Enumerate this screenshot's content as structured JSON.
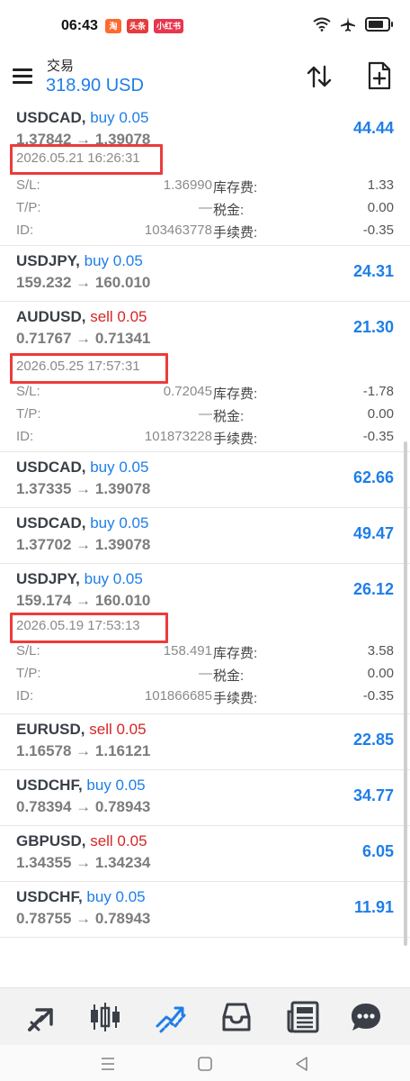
{
  "status": {
    "time": "06:43",
    "badge1": "淘",
    "badge2": "头条",
    "badge3": "小红书"
  },
  "header": {
    "title": "交易",
    "balance": "318.90 USD"
  },
  "labels": {
    "sl": "S/L:",
    "tp": "T/P:",
    "id": "ID:",
    "swap": "库存费:",
    "tax": "税金:",
    "fee": "手续费:"
  },
  "positions": [
    {
      "symbol": "USDCAD,",
      "dir": "buy 0.05",
      "side": "buy",
      "prices": "1.37842 → 1.39078",
      "profit": "44.44",
      "datetime": "2026.05.21 16:26:31",
      "sl": "1.36990",
      "tp": "—",
      "id": "103463778",
      "swap": "1.33",
      "tax": "0.00",
      "fee": "-0.35"
    },
    {
      "symbol": "USDJPY,",
      "dir": "buy 0.05",
      "side": "buy",
      "prices": "159.232 → 160.010",
      "profit": "24.31"
    },
    {
      "symbol": "AUDUSD,",
      "dir": "sell 0.05",
      "side": "sell",
      "prices": "0.71767 → 0.71341",
      "profit": "21.30",
      "datetime": "2026.05.25 17:57:31",
      "sl": "0.72045",
      "tp": "—",
      "id": "101873228",
      "swap": "-1.78",
      "tax": "0.00",
      "fee": "-0.35"
    },
    {
      "symbol": "USDCAD,",
      "dir": "buy 0.05",
      "side": "buy",
      "prices": "1.37335 → 1.39078",
      "profit": "62.66"
    },
    {
      "symbol": "USDCAD,",
      "dir": "buy 0.05",
      "side": "buy",
      "prices": "1.37702 → 1.39078",
      "profit": "49.47"
    },
    {
      "symbol": "USDJPY,",
      "dir": "buy 0.05",
      "side": "buy",
      "prices": "159.174 → 160.010",
      "profit": "26.12",
      "datetime": "2026.05.19 17:53:13",
      "sl": "158.491",
      "tp": "—",
      "id": "101866685",
      "swap": "3.58",
      "tax": "0.00",
      "fee": "-0.35"
    },
    {
      "symbol": "EURUSD,",
      "dir": "sell 0.05",
      "side": "sell",
      "prices": "1.16578 → 1.16121",
      "profit": "22.85"
    },
    {
      "symbol": "USDCHF,",
      "dir": "buy 0.05",
      "side": "buy",
      "prices": "0.78394 → 0.78943",
      "profit": "34.77"
    },
    {
      "symbol": "GBPUSD,",
      "dir": "sell 0.05",
      "side": "sell",
      "prices": "1.34355 → 1.34234",
      "profit": "6.05"
    },
    {
      "symbol": "USDCHF,",
      "dir": "buy 0.05",
      "side": "buy",
      "prices": "0.78755 → 0.78943",
      "profit": "11.91"
    }
  ],
  "colors": {
    "accent": "#1e7ee8",
    "sell": "#d62525",
    "highlight_box": "#ec3b3b"
  },
  "tabs": [
    "quotes-icon",
    "chart-icon",
    "trade-icon",
    "history-icon",
    "news-icon",
    "chat-icon"
  ]
}
